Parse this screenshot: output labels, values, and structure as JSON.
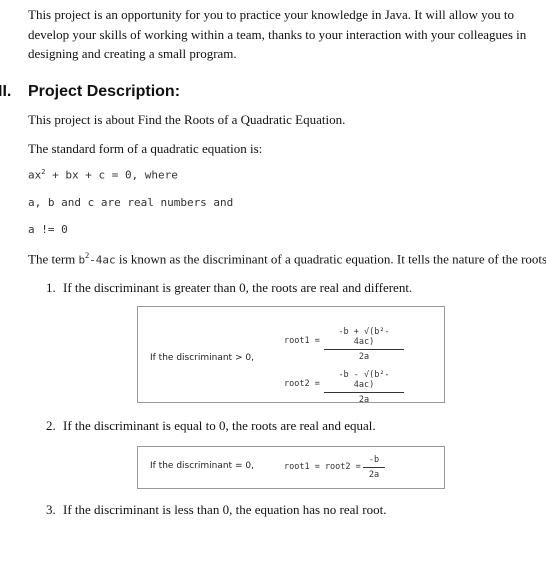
{
  "intro": "This project is an opportunity for you to practice your knowledge in Java. It will allow you to develop your skills of working within a team, thanks to your interaction with your colleagues in designing and creating a small program.",
  "section": {
    "number": "II.",
    "title": "Project Description:"
  },
  "p1": "This project is about Find the Roots of a Quadratic Equation.",
  "p2": "The standard form of a quadratic equation is:",
  "eq1": {
    "a": "ax",
    "sup": "2",
    "rest": " + bx + c = 0, where"
  },
  "eq2": "a, b and c are real numbers and",
  "eq3": "a != 0",
  "p3": {
    "pre": "The term ",
    "b": "b",
    "sup": "2",
    "code": "-4ac",
    "post": " is known as the discriminant of a quadratic equation. It tells the nature of the roots."
  },
  "items": [
    {
      "num": "1.",
      "text": "If the discriminant is greater than 0, the roots are real and different."
    },
    {
      "num": "2.",
      "text": "If the discriminant is equal to 0, the roots are real and equal."
    },
    {
      "num": "3.",
      "text": "If the discriminant is less than 0, the equation has no real root."
    }
  ],
  "box1": {
    "label": "If the discriminant > 0,",
    "root1": "root1 =",
    "num1": "-b + √(b²- 4ac)",
    "root2": "root2 =",
    "num2": "-b - √(b²- 4ac)",
    "den": "2a"
  },
  "box2": {
    "label": "If the discriminant = 0,",
    "roots": "root1 = root2 =",
    "num": "-b",
    "den": "2a"
  }
}
